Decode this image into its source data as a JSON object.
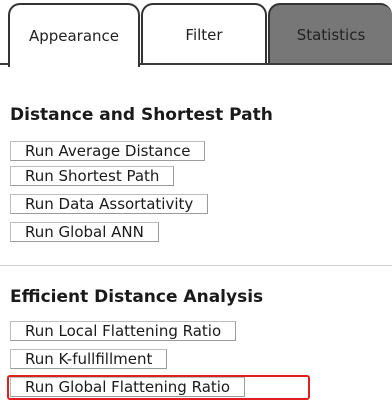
{
  "tabs": [
    {
      "label": "Appearance"
    },
    {
      "label": "Filter"
    },
    {
      "label": "Statistics"
    }
  ],
  "sections": [
    {
      "title": "Distance and Shortest Path",
      "buttons": [
        {
          "label": "Run Average Distance"
        },
        {
          "label": "Run Shortest Path"
        },
        {
          "label": "Run Data Assortativity"
        },
        {
          "label": "Run Global ANN"
        }
      ]
    },
    {
      "title": "Efficient Distance Analysis",
      "buttons": [
        {
          "label": "Run Local Flattening Ratio"
        },
        {
          "label": "Run K-fullfillment"
        },
        {
          "label": "Run Global Flattening Ratio"
        }
      ]
    }
  ],
  "highlighted_button": "Run Global Flattening Ratio",
  "colors": {
    "highlight": "#e02020",
    "disabled_tab": "#777777"
  }
}
